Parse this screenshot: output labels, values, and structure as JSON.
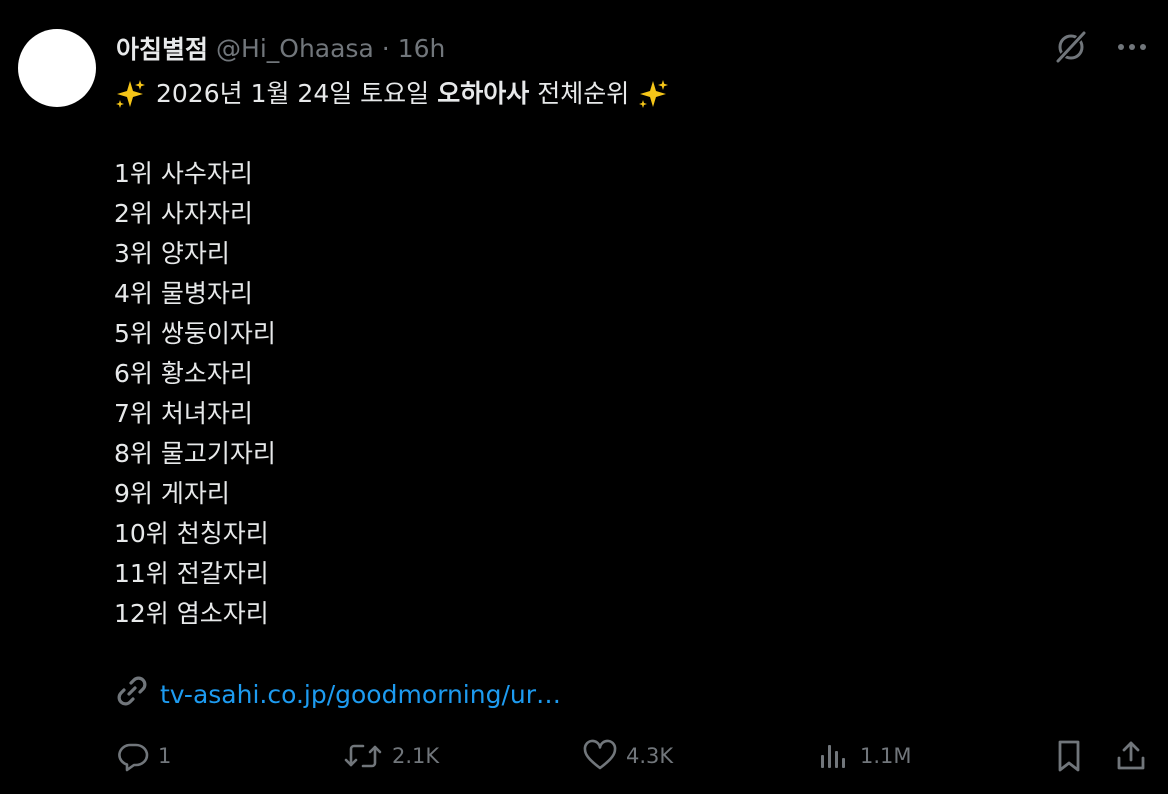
{
  "tweet": {
    "author": {
      "display_name": "아침별점",
      "handle": "@Hi_Ohaasa",
      "separator": "·",
      "time": "16h"
    },
    "headline": {
      "prefix": "2026년 1월 24일 토요일",
      "bold": "오하아사",
      "suffix": "전체순위"
    },
    "rankings": [
      "1위 사수자리",
      "2위 사자자리",
      "3위 양자리",
      "4위 물병자리",
      "5위 쌍둥이자리",
      "6위 황소자리",
      "7위 처녀자리",
      "8위 물고기자리",
      "9위 게자리",
      "10위 천칭자리",
      "11위 전갈자리",
      "12위 염소자리"
    ],
    "link": {
      "text": "tv-asahi.co.jp/goodmorning/ur…",
      "icon": "link-icon"
    },
    "actions": {
      "replies": "1",
      "reposts": "2.1K",
      "likes": "4.3K",
      "views": "1.1M"
    }
  },
  "colors": {
    "background": "#000000",
    "text": "#e7e9ea",
    "muted": "#71767b",
    "link": "#1d9bf0",
    "sparkle": "#f5c518"
  }
}
